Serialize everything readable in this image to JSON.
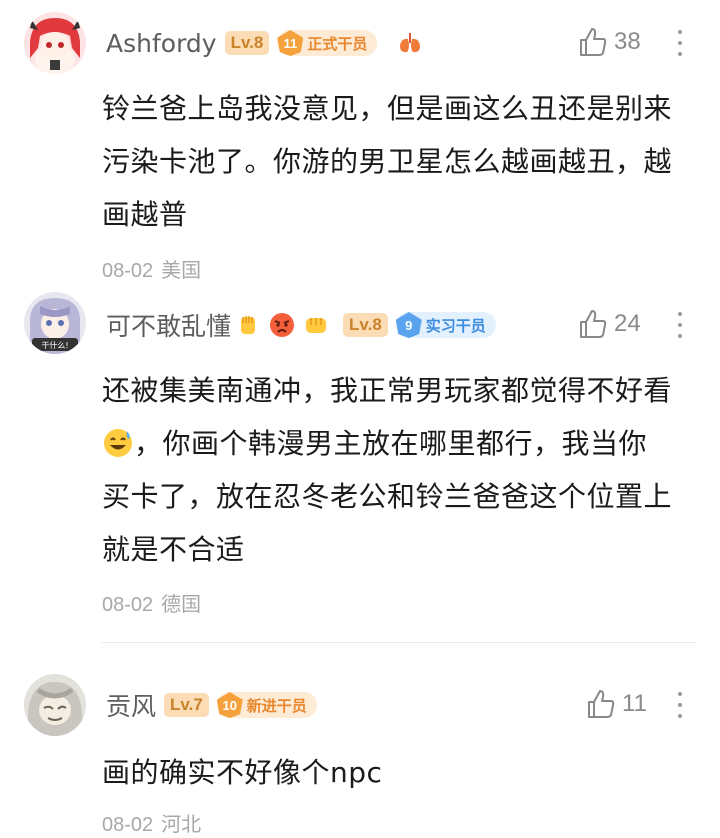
{
  "comments": [
    {
      "username": "Ashfordy",
      "level": "Lv.8",
      "role_num": "11",
      "role": "正式干员",
      "likes": "38",
      "lines": [
        "铃兰爸上岛我没意见，但是画这么丑还是别来",
        "污染卡池了。你游的男卫星怎么越画越丑，越",
        "画越普"
      ],
      "date": "08-02",
      "location": "美国"
    },
    {
      "username": "可不敢乱懂",
      "avatar_text": "干什么!",
      "level": "Lv.8",
      "role_num": "9",
      "role": "实习干员",
      "likes": "24",
      "line1": "还被集美南通冲，我正常男玩家都觉得不好看",
      "line2_after_emoji": "，你画个韩漫男主放在哪里都行，我当你",
      "line3": "买卡了，放在忍冬老公和铃兰爸爸这个位置上",
      "line4": "就是不合适",
      "date": "08-02",
      "location": "德国"
    },
    {
      "username": "贡风",
      "level": "Lv.7",
      "role_num": "10",
      "role": "新进干员",
      "likes": "11",
      "lines": [
        "画的确实不好像个npc"
      ],
      "date": "08-02",
      "location": "河北"
    }
  ],
  "colors": {
    "lv_bg": "#fcdcb4",
    "lv_text": "#c9832a",
    "role_orange_bg": "#fdebd6",
    "role_orange_text": "#e8872d",
    "role_blue_bg": "#e3f0fd",
    "role_blue_text": "#3d8de0"
  },
  "icons": [
    "thumbs-up-icon",
    "more-vert-icon",
    "lungs-icon",
    "raised-fist-emoji",
    "angry-face-emoji",
    "oncoming-fist-emoji",
    "sweat-smile-emoji"
  ]
}
